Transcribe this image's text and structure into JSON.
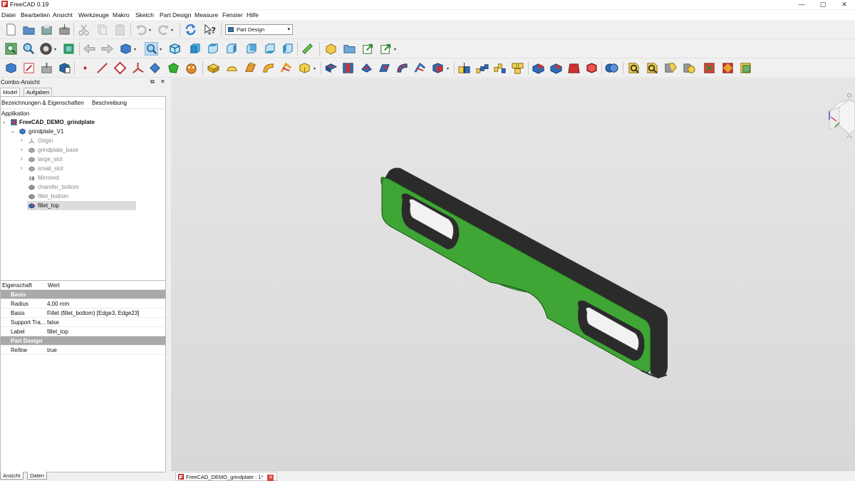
{
  "window": {
    "title": "FreeCAD 0.19"
  },
  "menu": [
    "Datei",
    "Bearbeiten",
    "Ansicht",
    "Werkzeuge",
    "Makro",
    "Sketch",
    "Part Design",
    "Measure",
    "Fenster",
    "Hilfe"
  ],
  "workbench": {
    "selected": "Part Design"
  },
  "combo": {
    "title": "Combo-Ansicht",
    "tabs": [
      "Model",
      "Aufgaben"
    ],
    "tree_header": [
      "Bezeichnungen & Eigenschaften",
      "Beschreibung"
    ],
    "root": "Applikation",
    "document": "FreeCAD_DEMO_grindplate",
    "body": "grindplate_V1",
    "features": [
      "Origin",
      "grindplate_base",
      "large_slot",
      "small_slot",
      "Mirrored",
      "chamfer_bottom",
      "fillet_bottom",
      "fillet_top"
    ]
  },
  "properties": {
    "header": [
      "Eigenschaft",
      "Wert"
    ],
    "groups": [
      {
        "name": "Basis",
        "rows": [
          {
            "key": "Radius",
            "value": "4,00 mm"
          },
          {
            "key": "Basis",
            "value": "Fillet (fillet_bottom) [Edge3, Edge23]"
          },
          {
            "key": "Support Tra...",
            "value": "false"
          },
          {
            "key": "Label",
            "value": "fillet_top"
          }
        ]
      },
      {
        "name": "Part Design",
        "rows": [
          {
            "key": "Refine",
            "value": "true"
          }
        ]
      }
    ]
  },
  "bottom_tabs": [
    "Ansicht",
    "Daten"
  ],
  "document_tab": "FreeCAD_DEMO_grindplate : 1*",
  "colors": {
    "part_face": "#3fa535",
    "part_edge": "#2b2b2b",
    "selection": "#dcdcdc"
  }
}
